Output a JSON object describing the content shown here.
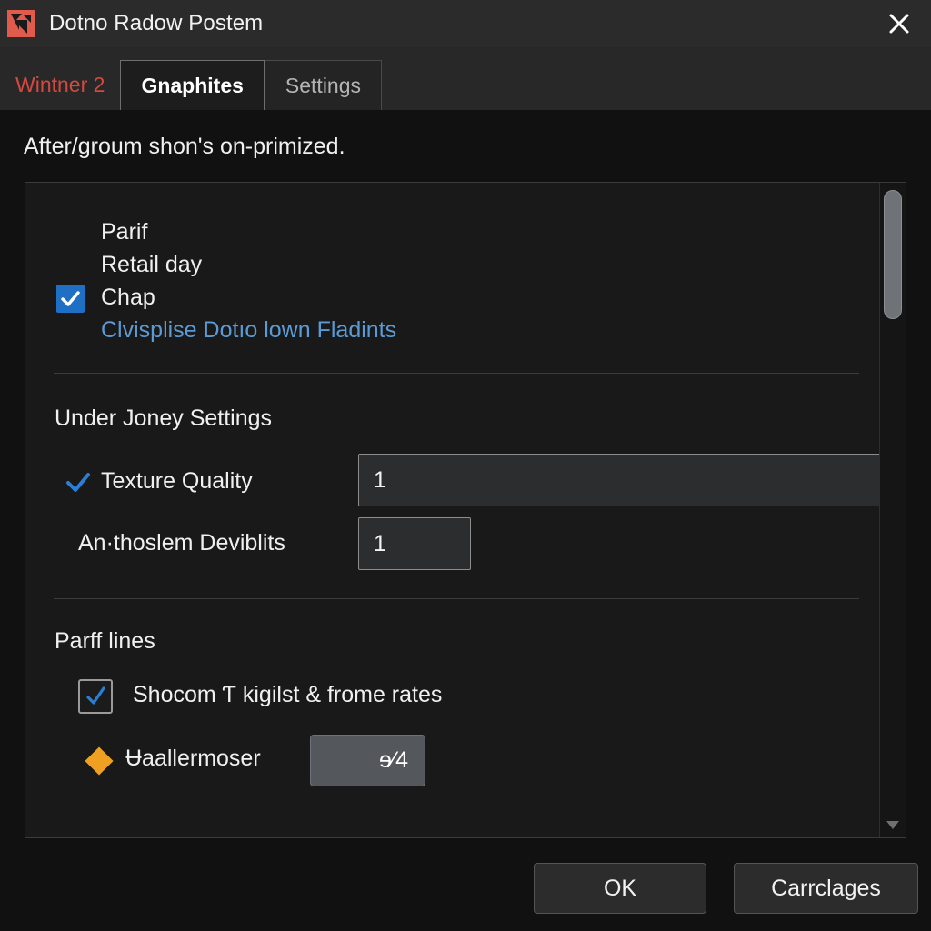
{
  "window": {
    "title": "Dotno Radow Postem",
    "app_icon": "dota-logo-icon",
    "close_label": "✕",
    "titlebar_bg": "#2b2b2b",
    "icon_bg": "#e15b4c"
  },
  "tabs": [
    {
      "label": "Wintner 2",
      "state": "plain",
      "color": "#d4493f"
    },
    {
      "label": "Gnaphites",
      "state": "active",
      "color": "#ffffff"
    },
    {
      "label": "Settings",
      "state": "inactive",
      "color": "#b4b4b4"
    }
  ],
  "subtitle": "After/groum shon's on-primized.",
  "panel": {
    "options_group": {
      "rows": [
        {
          "label": "Parif"
        },
        {
          "label": "Retail day"
        },
        {
          "label": "Chap",
          "checked": true
        }
      ],
      "link": "Clvisplise Dotıo lown Fladints",
      "link_color": "#5b9bd5"
    },
    "section_quality": {
      "heading": "Under Joney Settings",
      "fields": [
        {
          "label": "Texture Quality",
          "value": "1",
          "checked": true
        },
        {
          "label": "An·thoslem Deviblits",
          "value": "1",
          "checked": false
        }
      ]
    },
    "section_perf": {
      "heading": "Parff lines",
      "checkbox": {
        "label": "Shocom Ƭ kigilst & frome rates",
        "checked": true
      },
      "slider_row": {
        "label": "Ʉaallermoser",
        "value": "ɘ⁄4",
        "bullet_color": "#f0a020"
      }
    },
    "scrollbar": {
      "down_arrow": "▼",
      "thumb_position": "top"
    }
  },
  "footer": {
    "ok_label": "OK",
    "cancel_label": "Carrclages"
  }
}
